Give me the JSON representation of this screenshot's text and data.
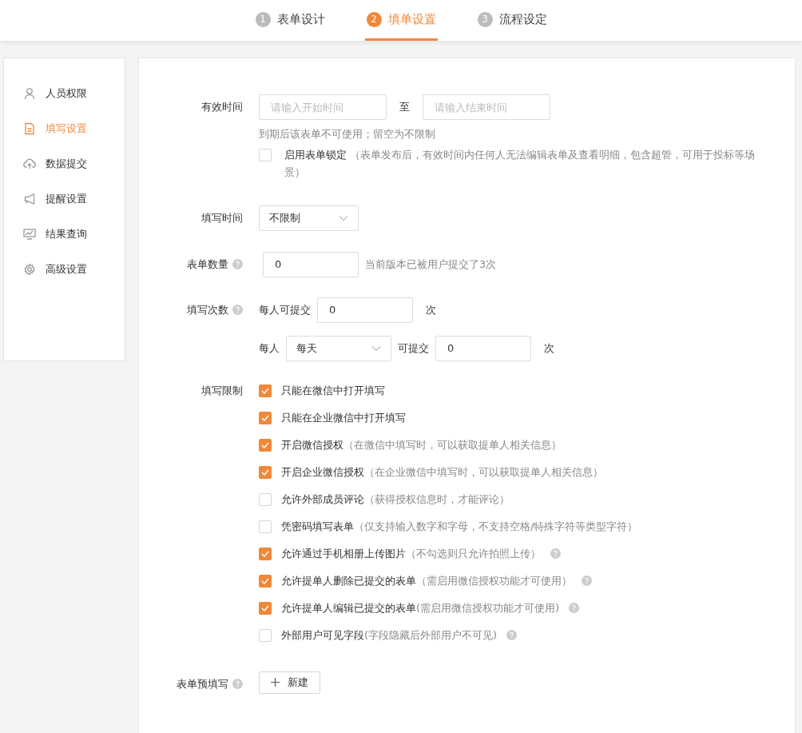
{
  "steps": [
    {
      "number": "1",
      "label": "表单设计",
      "selected": false
    },
    {
      "number": "2",
      "label": "填单设置",
      "selected": true
    },
    {
      "number": "3",
      "label": "流程设定",
      "selected": false
    }
  ],
  "sidebar": {
    "items": [
      {
        "kind": "person",
        "label": "人员权限",
        "selected": false
      },
      {
        "kind": "document",
        "label": "填写设置",
        "selected": true
      },
      {
        "kind": "upload",
        "label": "数据提交",
        "selected": false
      },
      {
        "kind": "megaphone",
        "label": "提醒设置",
        "selected": false
      },
      {
        "kind": "monitor",
        "label": "结果查询",
        "selected": false
      },
      {
        "kind": "gear",
        "label": "高级设置",
        "selected": false
      }
    ]
  },
  "valid_time": {
    "label": "有效时间",
    "start_placeholder": "请输入开始时间",
    "separator": "至",
    "end_placeholder": "请输入结束时间",
    "hint": "到期后该表单不可使用；留空为不限制",
    "lock": {
      "label": "启用表单锁定",
      "note": "（表单发布后，有效时间内任何人无法编辑表单及查看明细，包含超管，可用于投标等场景）",
      "checked": false
    }
  },
  "fill_time": {
    "label": "填写时间",
    "value": "不限制"
  },
  "form_count": {
    "label": "表单数量",
    "help": true,
    "value": "0",
    "note": "当前版本已被用户提交了3次"
  },
  "fill_count": {
    "label": "填写次数",
    "help": true,
    "prefix": "每人可提交",
    "value": "0",
    "unit": "次",
    "period_prefix": "每人",
    "period": "每天",
    "period_mid": "可提交",
    "period_value": "0",
    "period_unit": "次"
  },
  "restrictions": {
    "label": "填写限制",
    "options": [
      {
        "label": "只能在微信中打开填写",
        "checked": true,
        "help": false
      },
      {
        "label": "只能在企业微信中打开填写",
        "checked": true,
        "help": false
      },
      {
        "label": "开启微信授权",
        "note": "（在微信中填写时，可以获取提单人相关信息）",
        "checked": true,
        "help": false
      },
      {
        "label": "开启企业微信授权",
        "note": "（在企业微信中填写时，可以获取提单人相关信息）",
        "checked": true,
        "help": false
      },
      {
        "label": "允许外部成员评论",
        "note": "（获得授权信息时，才能评论）",
        "checked": false,
        "help": false
      },
      {
        "label": "凭密码填写表单",
        "note": "（仅支持输入数字和字母，不支持空格/特殊字符等类型字符）",
        "checked": false,
        "help": false
      },
      {
        "label": "允许通过手机相册上传图片",
        "note": "（不勾选则只允许拍照上传）",
        "checked": true,
        "help": true
      },
      {
        "label": "允许提单人删除已提交的表单",
        "note": "（需启用微信授权功能才可使用）",
        "checked": true,
        "help": true
      },
      {
        "label": "允许提单人编辑已提交的表单",
        "note": "(需启用微信授权功能才可使用)",
        "checked": true,
        "help": true
      },
      {
        "label": "外部用户可见字段",
        "note": "(字段隐藏后外部用户不可见)",
        "checked": false,
        "help": true
      }
    ]
  },
  "prefill": {
    "label": "表单预填写",
    "help": true,
    "button": "新建"
  }
}
